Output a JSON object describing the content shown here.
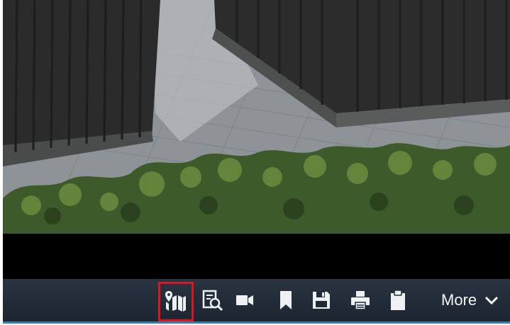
{
  "toolbar": {
    "more_label": "More",
    "icons": [
      {
        "name": "map-icon"
      },
      {
        "name": "search-recording-icon"
      },
      {
        "name": "video-camera-icon"
      },
      {
        "name": "bookmark-icon"
      },
      {
        "name": "save-icon"
      },
      {
        "name": "print-icon"
      },
      {
        "name": "clipboard-icon"
      }
    ],
    "highlighted_button": "map-icon"
  },
  "colors": {
    "toolbar_bg": "#1f2a36",
    "icon": "#eef1f4",
    "highlight": "#e0141e",
    "accent": "#2f7fc2"
  }
}
